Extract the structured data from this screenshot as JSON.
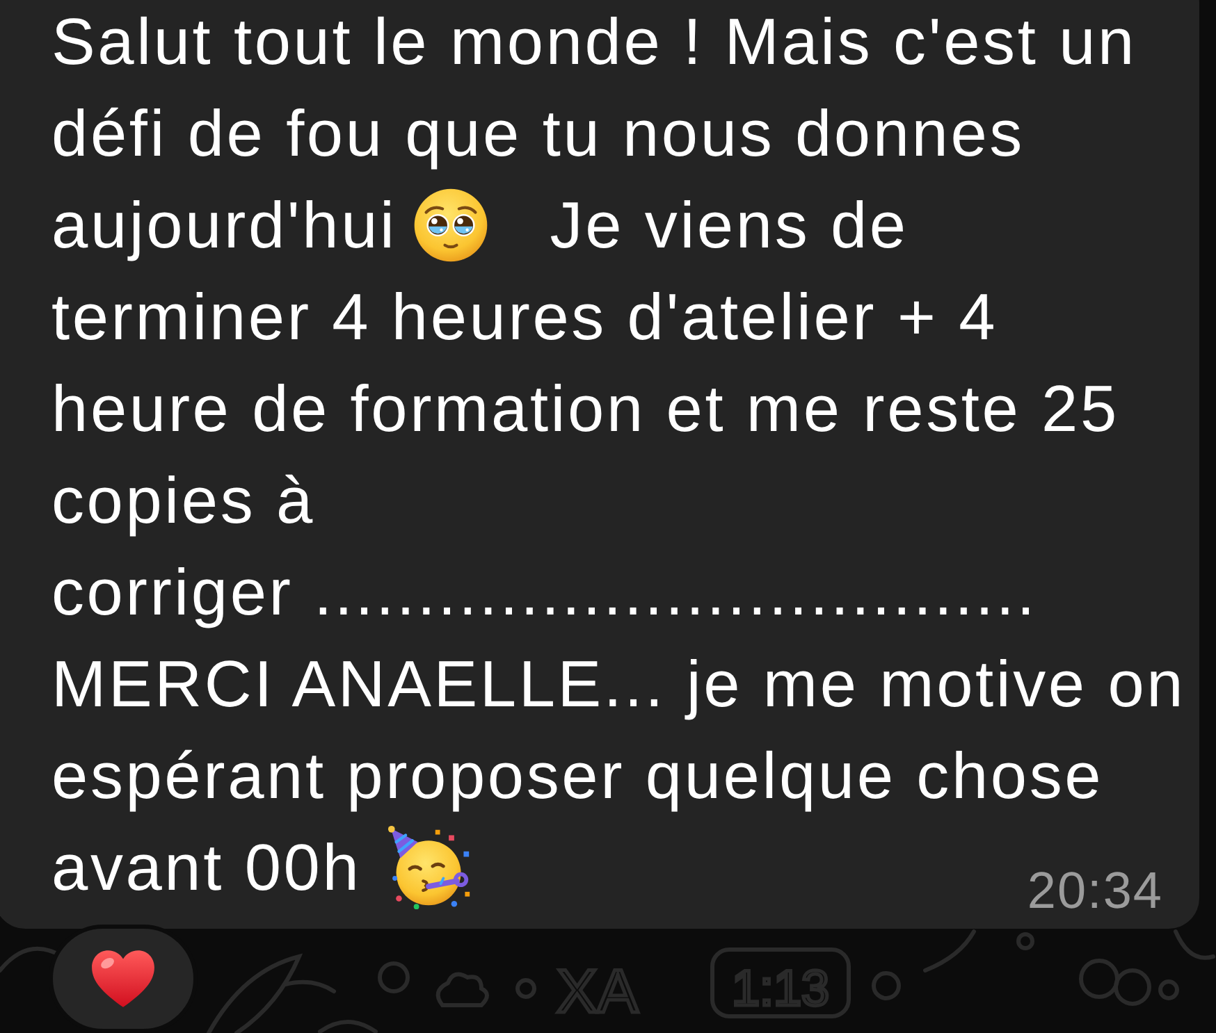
{
  "message": {
    "lines": [
      [
        {
          "kind": "text",
          "text": "Salut tout le monde ! Mais c'est un"
        }
      ],
      [
        {
          "kind": "text",
          "text": "défi de fou que tu nous donnes"
        }
      ],
      [
        {
          "kind": "text",
          "text": "aujourd'hui"
        },
        {
          "kind": "teary"
        },
        {
          "kind": "text",
          "text": "Je viens de"
        }
      ],
      [
        {
          "kind": "text",
          "text": "terminer 4 heures d'atelier + 4"
        }
      ],
      [
        {
          "kind": "text",
          "text": "heure de formation et me reste 25"
        }
      ],
      [
        {
          "kind": "text",
          "text": "copies à"
        }
      ],
      [
        {
          "kind": "text",
          "text": "corriger ..................................."
        }
      ],
      [
        {
          "kind": "text",
          "text": "MERCI ANAELLE... je me motive on"
        }
      ],
      [
        {
          "kind": "text",
          "text": "espérant proposer quelque chose"
        }
      ],
      [
        {
          "kind": "text",
          "text": "avant 00h"
        },
        {
          "kind": "party"
        }
      ]
    ],
    "time": "20:34"
  },
  "reactions": [
    {
      "kind": "heart"
    }
  ],
  "wallpaper": {
    "doodle_texts": [
      "XA",
      "1:13"
    ]
  }
}
